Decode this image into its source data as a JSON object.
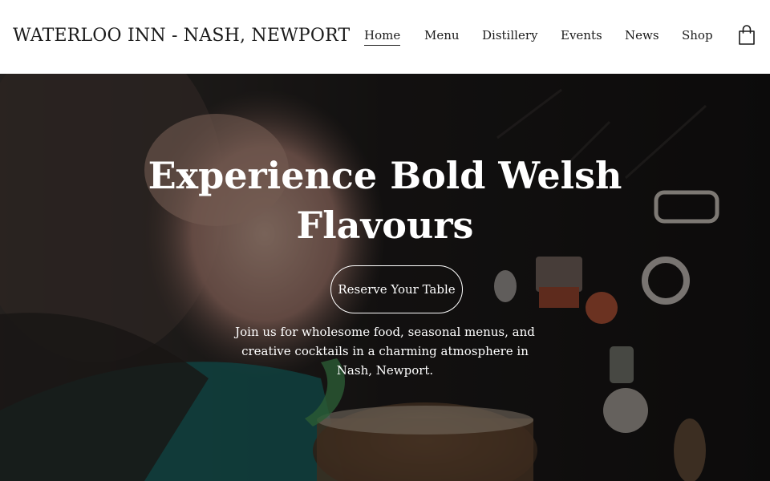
{
  "header": {
    "site_title": "WATERLOO INN - NASH, NEWPORT",
    "nav": [
      {
        "label": "Home",
        "active": true
      },
      {
        "label": "Menu",
        "active": false
      },
      {
        "label": "Distillery",
        "active": false
      },
      {
        "label": "Events",
        "active": false
      },
      {
        "label": "News",
        "active": false
      },
      {
        "label": "Shop",
        "active": false
      }
    ],
    "cart_icon": "shopping-bag-icon"
  },
  "hero": {
    "heading": "Experience Bold Welsh Flavours",
    "button_label": "Reserve Your Table",
    "description": "Join us for wholesome food, seasonal menus, and creative cocktails in a charming atmosphere in Nash, Newport."
  },
  "colors": {
    "header_bg": "#ffffff",
    "text_dark": "#1b1b1b",
    "hero_text": "#ffffff"
  }
}
